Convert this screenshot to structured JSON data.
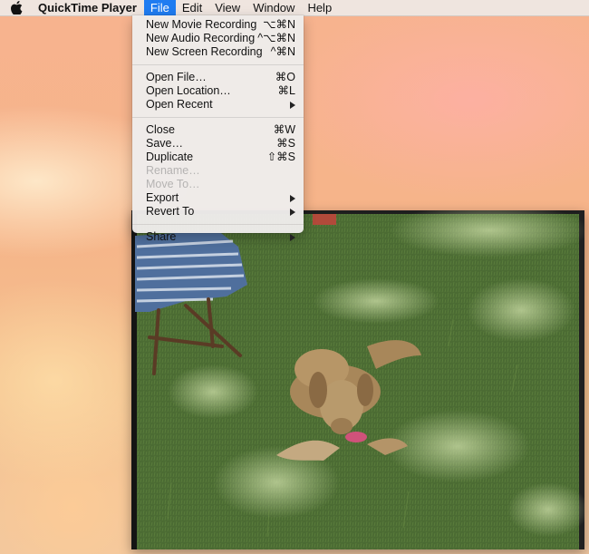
{
  "menubar": {
    "apple_icon": "apple-icon",
    "app_name": "QuickTime Player",
    "menus": [
      "File",
      "Edit",
      "View",
      "Window",
      "Help"
    ],
    "active_menu": "File"
  },
  "file_menu": {
    "groups": [
      [
        {
          "label": "New Movie Recording",
          "shortcut": "⌥⌘N"
        },
        {
          "label": "New Audio Recording",
          "shortcut": "^⌥⌘N"
        },
        {
          "label": "New Screen Recording",
          "shortcut": "^⌘N"
        }
      ],
      [
        {
          "label": "Open File…",
          "shortcut": "⌘O"
        },
        {
          "label": "Open Location…",
          "shortcut": "⌘L"
        },
        {
          "label": "Open Recent",
          "submenu": true
        }
      ],
      [
        {
          "label": "Close",
          "shortcut": "⌘W"
        },
        {
          "label": "Save…",
          "shortcut": "⌘S"
        },
        {
          "label": "Duplicate",
          "shortcut": "⇧⌘S"
        },
        {
          "label": "Rename…",
          "disabled": true
        },
        {
          "label": "Move To…",
          "disabled": true
        },
        {
          "label": "Export",
          "submenu": true
        },
        {
          "label": "Revert To",
          "submenu": true
        }
      ],
      [
        {
          "label": "Share",
          "submenu": true
        }
      ]
    ]
  },
  "video_window": {
    "content": "golden retriever lying on grass chewing a toy"
  },
  "colors": {
    "menu_highlight": "#1f7cf1",
    "disabled_text": "#b5b3b2"
  }
}
